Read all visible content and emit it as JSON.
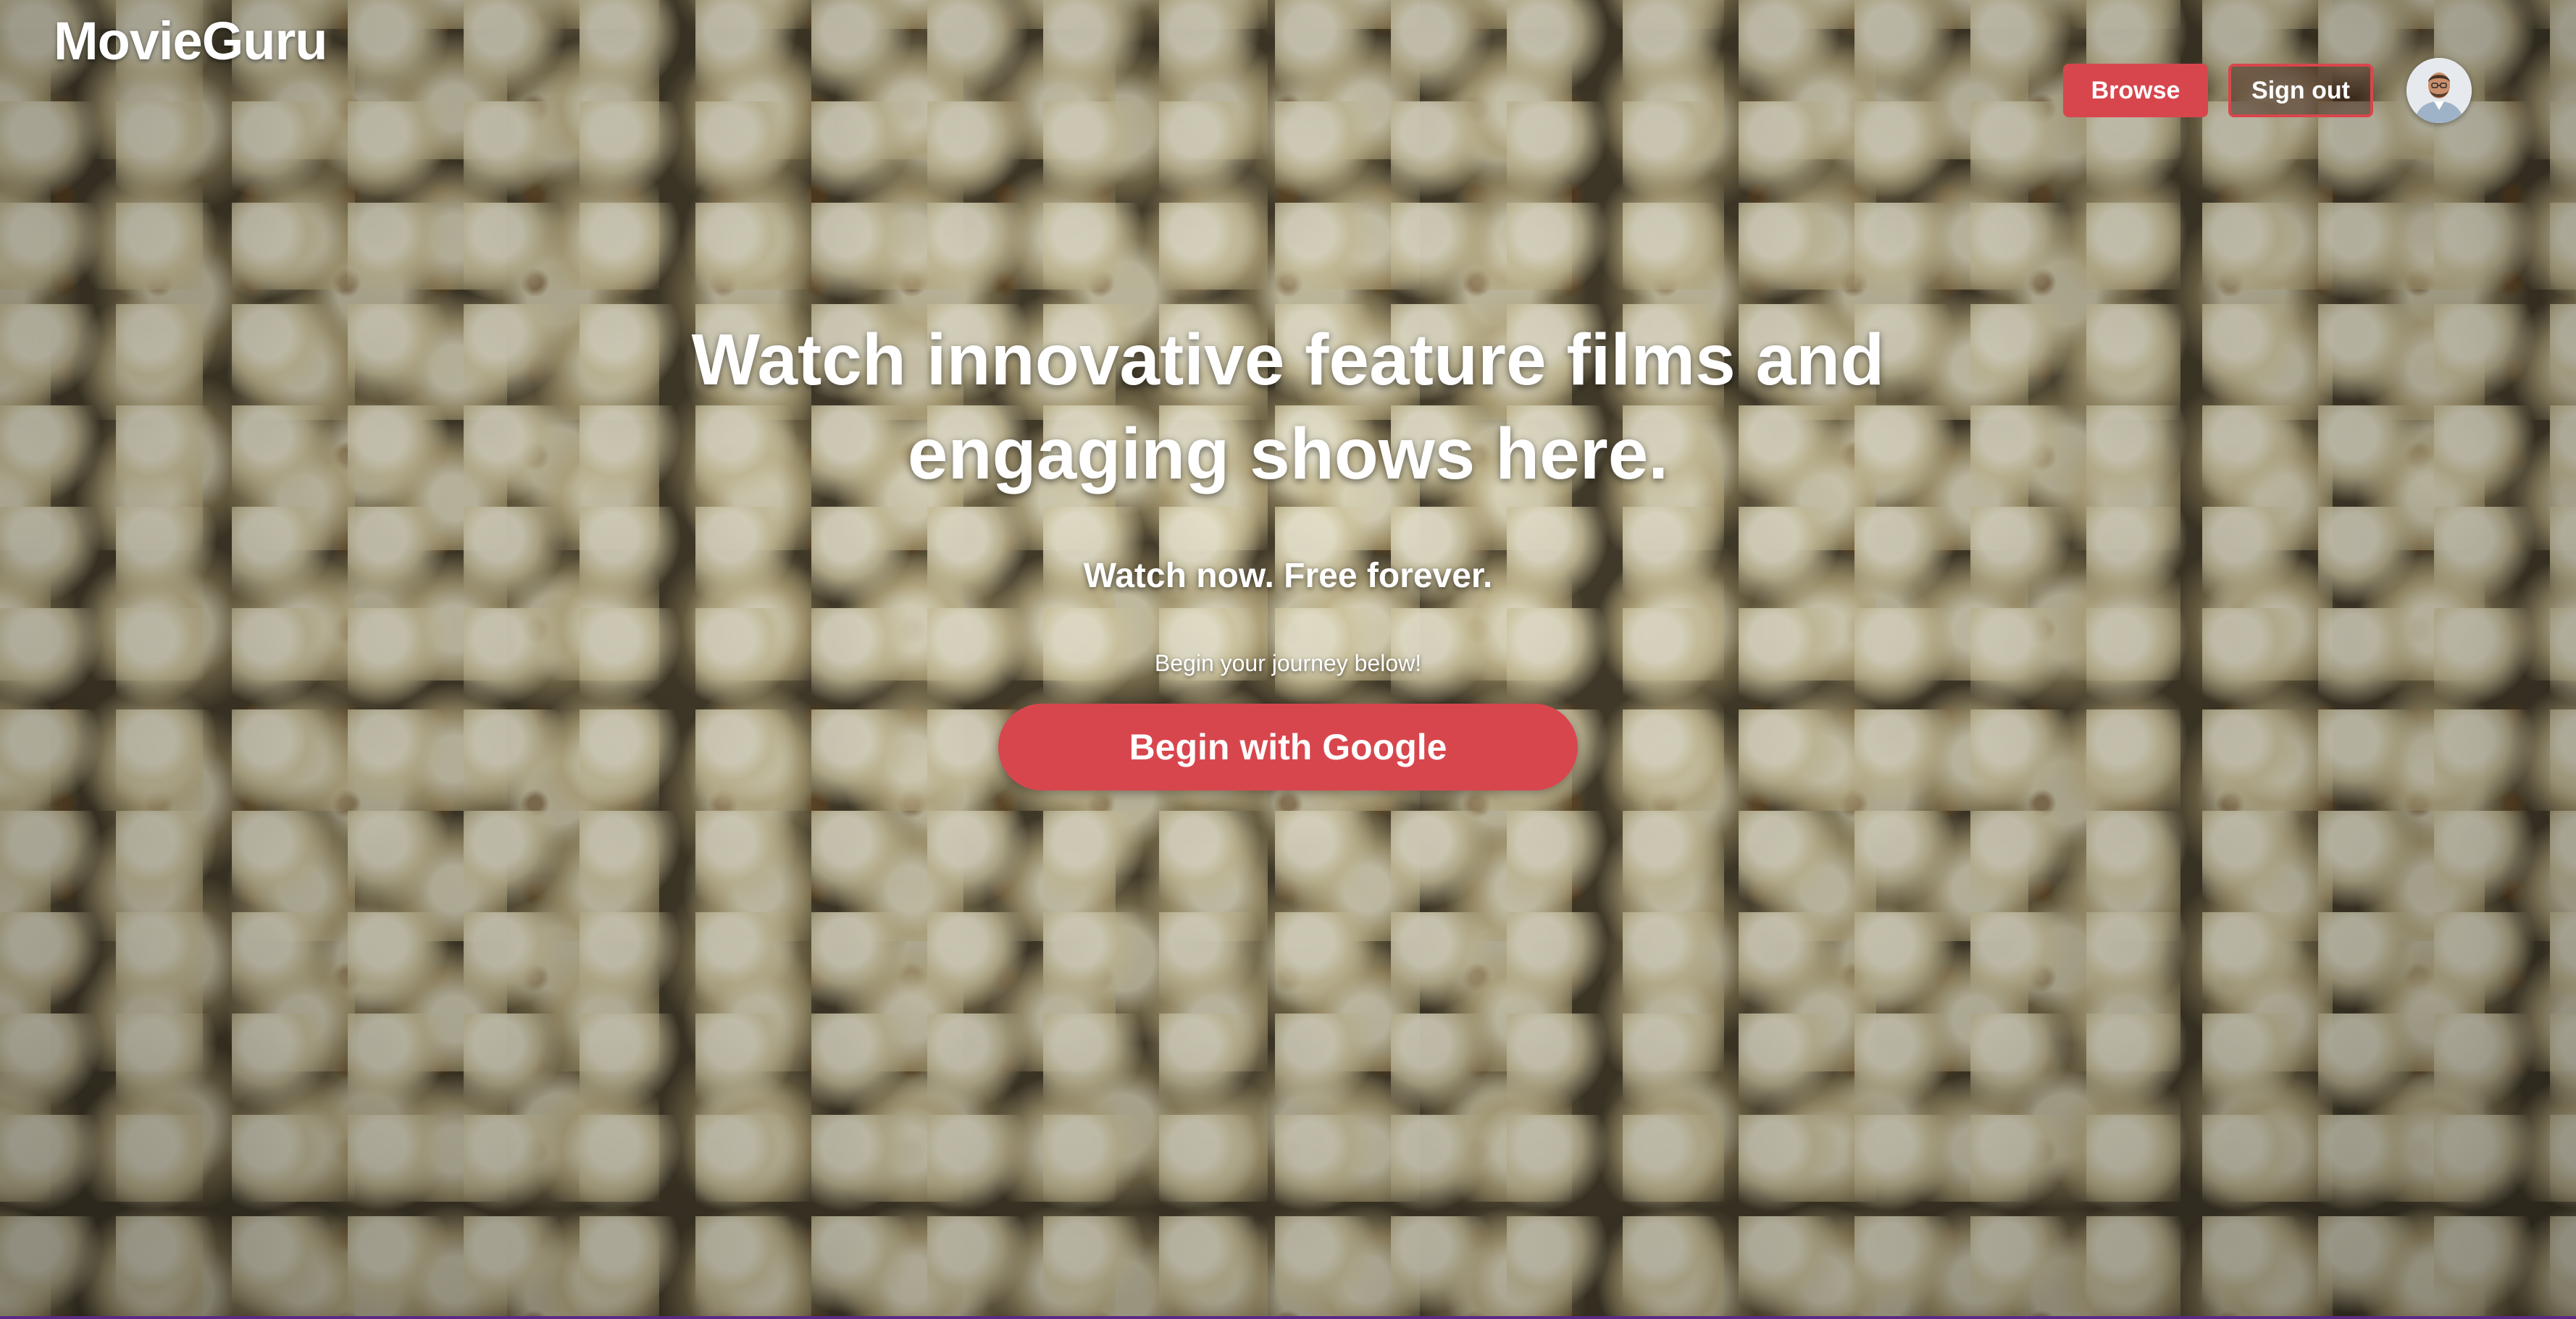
{
  "header": {
    "logo": "MovieGuru",
    "browse_label": "Browse",
    "signout_label": "Sign out"
  },
  "hero": {
    "headline_line1": "Watch innovative feature films and",
    "headline_line2": "engaging shows here.",
    "subhead": "Watch now. Free forever.",
    "cta_label": "Begin your journey below!",
    "cta_button": "Begin with Google",
    "background": "popcorn photo"
  },
  "colors": {
    "accent": "#d8464d",
    "text": "#ffffff"
  }
}
